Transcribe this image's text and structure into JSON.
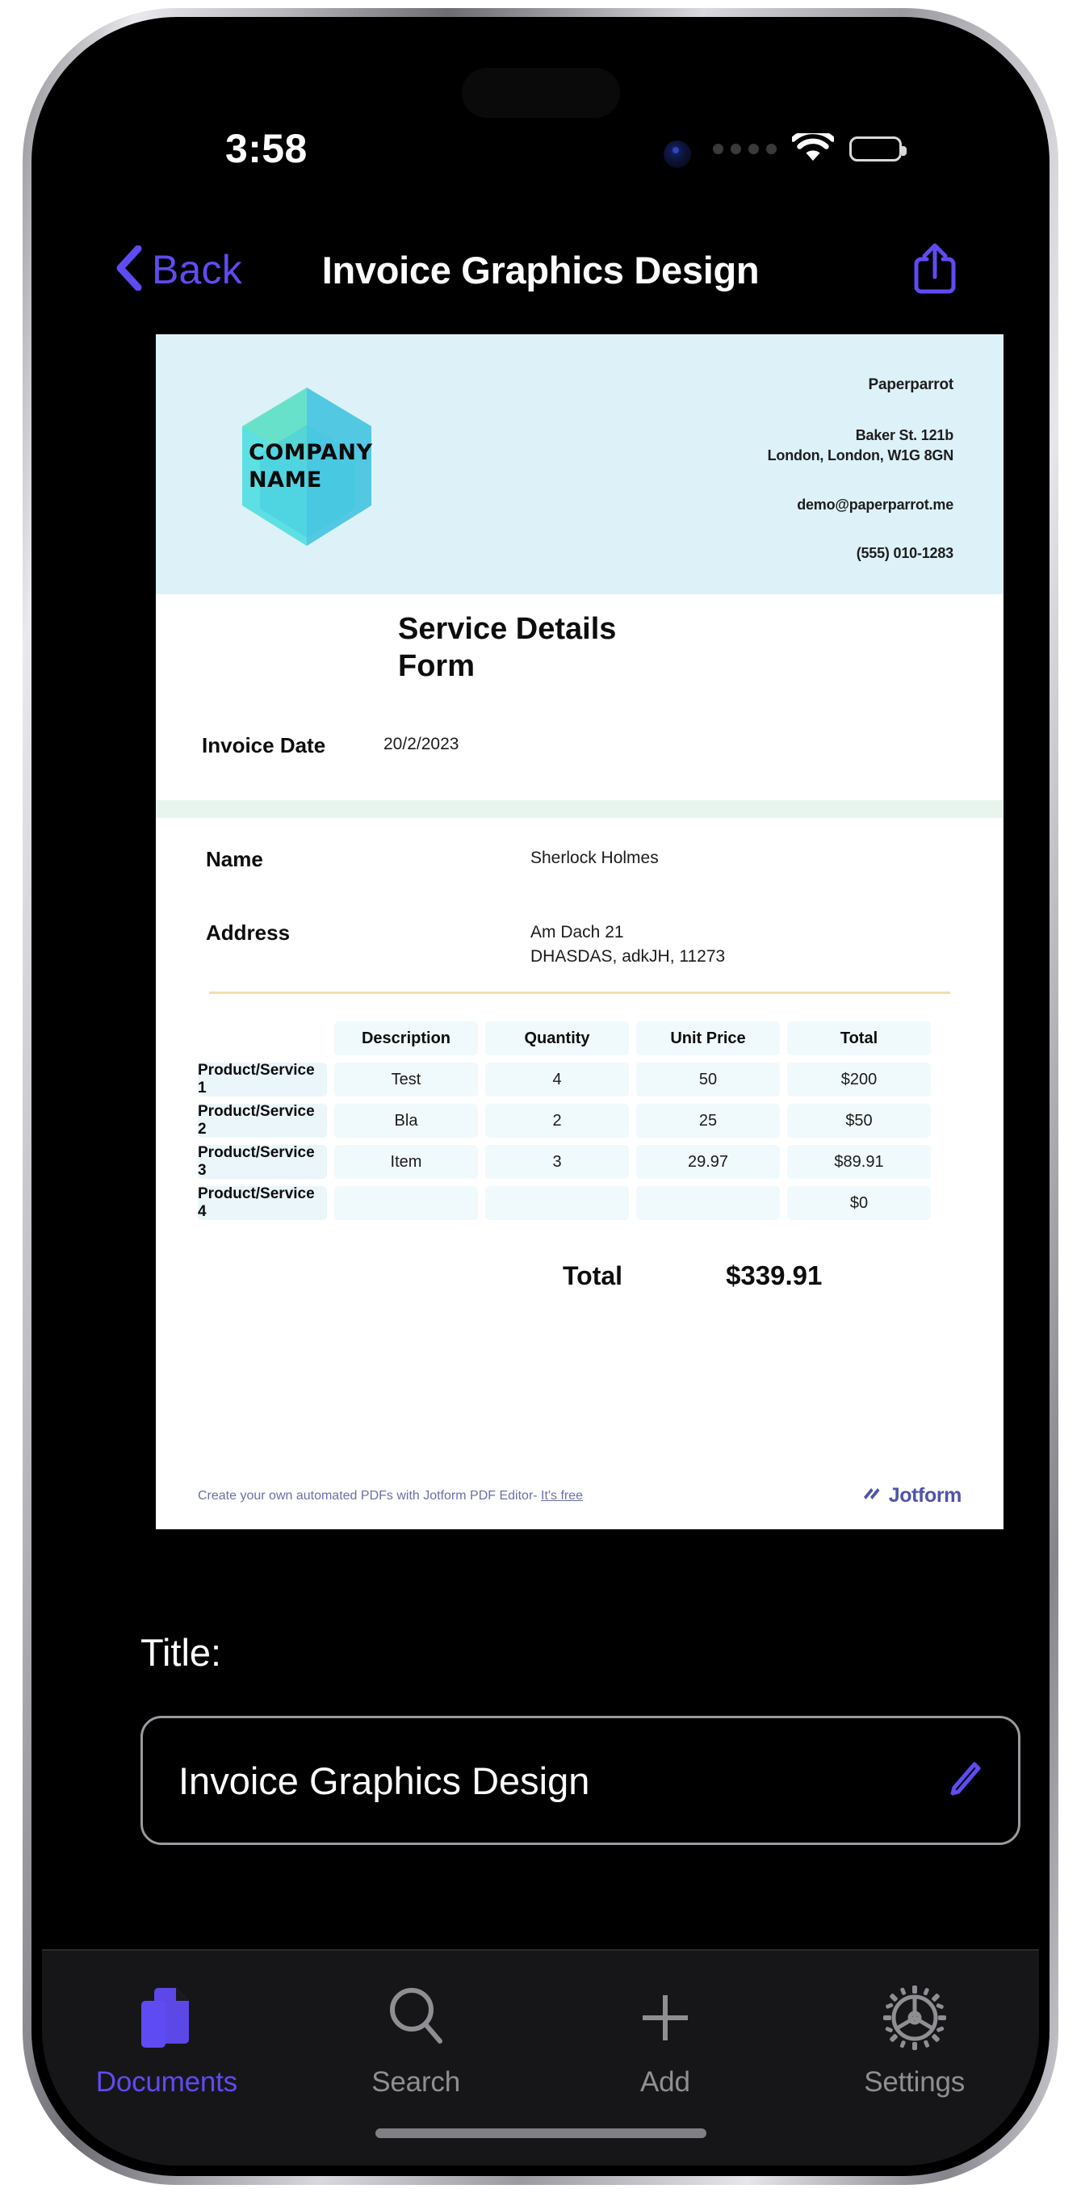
{
  "status_bar": {
    "time": "3:58",
    "signal_icon": "signal-dots-icon",
    "wifi_icon": "wifi-icon",
    "battery_icon": "battery-icon"
  },
  "nav_bar": {
    "back_label": "Back",
    "back_icon": "chevron-left-icon",
    "title": "Invoice Graphics Design",
    "share_icon": "share-icon"
  },
  "document": {
    "company_logo": {
      "line1": "COMPANY",
      "line2": "NAME"
    },
    "company": {
      "name": "Paperparrot",
      "address_line1": "Baker St. 121b",
      "address_line2": "London, London, W1G 8GN",
      "email": "demo@paperparrot.me",
      "phone": "(555) 010-1283"
    },
    "form_title_line1": "Service Details",
    "form_title_line2": "Form",
    "invoice_date_label": "Invoice Date",
    "invoice_date_value": "20/2/2023",
    "name_label": "Name",
    "name_value": "Sherlock Holmes",
    "address_label": "Address",
    "address_line1": "Am Dach 21",
    "address_line2": "DHASDAS, adkJH, 11273",
    "table": {
      "headers": [
        "",
        "Description",
        "Quantity",
        "Unit Price",
        "Total"
      ],
      "rows": [
        {
          "label": "Product/Service 1",
          "description": "Test",
          "quantity": "4",
          "unit_price": "50",
          "total": "$200"
        },
        {
          "label": "Product/Service 2",
          "description": "Bla",
          "quantity": "2",
          "unit_price": "25",
          "total": "$50"
        },
        {
          "label": "Product/Service 3",
          "description": "Item",
          "quantity": "3",
          "unit_price": "29.97",
          "total": "$89.91"
        },
        {
          "label": "Product/Service 4",
          "description": "",
          "quantity": "",
          "unit_price": "",
          "total": "$0"
        }
      ]
    },
    "totals_label": "Total",
    "totals_value": "$339.91",
    "footer_text_before": "Create your own automated PDFs with Jotform PDF Editor- ",
    "footer_link": "It's free",
    "footer_brand": "Jotform"
  },
  "title_section": {
    "label": "Title:",
    "value": "Invoice Graphics Design",
    "placeholder": "Invoice Graphics Design",
    "edit_icon": "pencil-icon"
  },
  "tab_bar": {
    "items": [
      {
        "label": "Documents",
        "icon": "documents-icon",
        "active": true
      },
      {
        "label": "Search",
        "icon": "search-icon",
        "active": false
      },
      {
        "label": "Add",
        "icon": "plus-icon",
        "active": false
      },
      {
        "label": "Settings",
        "icon": "gear-icon",
        "active": false
      }
    ]
  },
  "colors": {
    "accent": "#5F4BF2",
    "inactive": "#8E8E93",
    "invoice_header_bg": "#DDF1F9",
    "teal_rule": "#36C8D8",
    "green_band": "#E8F5EF",
    "orange_rule": "#F5DCAE",
    "table_cell_bg": "#F0F9FB",
    "jotform_purple": "#4F55A8"
  }
}
